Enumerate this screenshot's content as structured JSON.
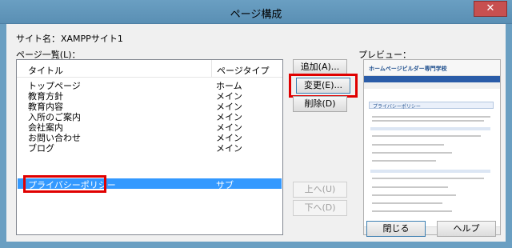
{
  "window": {
    "title": "ページ構成",
    "close_glyph": "✕"
  },
  "site": {
    "label": "サイト名：",
    "name": "XAMPPサイト1"
  },
  "page_list": {
    "label": "ページ一覧(L)：",
    "columns": [
      "タイトル",
      "ページタイプ"
    ],
    "rows": [
      {
        "title": "トップページ",
        "type": "ホーム"
      },
      {
        "title": "教育方針",
        "type": "メイン"
      },
      {
        "title": "教育内容",
        "type": "メイン"
      },
      {
        "title": "入所のご案内",
        "type": "メイン"
      },
      {
        "title": "会社案内",
        "type": "メイン"
      },
      {
        "title": "お問い合わせ",
        "type": "メイン"
      },
      {
        "title": "ブログ",
        "type": "メイン"
      },
      {
        "title": "プライバシーポリシー",
        "type": "サブ"
      }
    ],
    "selected_index": 7
  },
  "buttons": {
    "add": "追加(A)...",
    "edit": "変更(E)...",
    "delete": "削除(D)",
    "up": "上へ(U)",
    "down": "下へ(D)",
    "close": "閉じる",
    "help": "ヘルプ"
  },
  "preview": {
    "label": "プレビュー：",
    "logo": "ホームページビルダー専門学校",
    "section_title": "プライバシーポリシー"
  },
  "colors": {
    "highlight": "#e00000",
    "selection": "#3399ff",
    "titlebar": "#6a9fc2"
  }
}
